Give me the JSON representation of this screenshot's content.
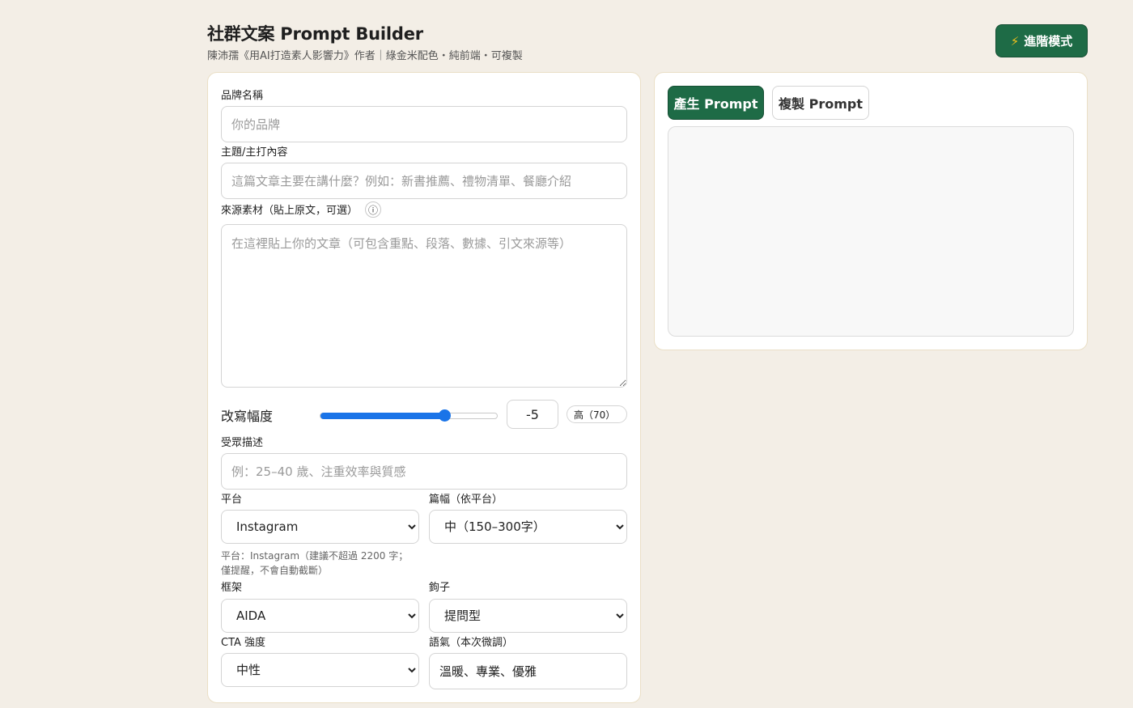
{
  "header": {
    "title": "社群文案 Prompt Builder",
    "subtitle": "陳沛孺《用AI打造素人影響力》作者｜綠金米配色・純前端・可複製",
    "advanced_button": "進階模式",
    "advanced_icon": "lightning-icon"
  },
  "form": {
    "brand": {
      "label": "品牌名稱",
      "placeholder": "你的品牌",
      "value": ""
    },
    "topic": {
      "label": "主題/主打內容",
      "placeholder": "這篇文章主要在講什麼？例如：新書推薦、禮物清單、餐廳介紹",
      "value": ""
    },
    "source": {
      "label": "來源素材（貼上原文，可選）",
      "info_icon": "ⓘ",
      "placeholder": "在這裡貼上你的文章（可包含重點、段落、數據、引文來源等）",
      "value": ""
    },
    "rewrite": {
      "label": "改寫幅度",
      "slider_fraction": 0.7,
      "number_value": "-5",
      "level_text": "高（70）"
    },
    "audience": {
      "label": "受眾描述",
      "placeholder": "例：25–40 歲、注重效率與質感",
      "value": ""
    },
    "platform": {
      "label": "平台",
      "selected": "Instagram",
      "hint": "平台：Instagram（建議不超過 2200 字；僅提醒，不會自動截斷）"
    },
    "length": {
      "label": "篇幅（依平台）",
      "selected": "中（150–300字）"
    },
    "framework": {
      "label": "框架",
      "selected": "AIDA"
    },
    "hook": {
      "label": "鉤子",
      "selected": "提問型"
    },
    "cta": {
      "label": "CTA 強度",
      "selected": "中性"
    },
    "tone": {
      "label": "語氣（本次微調）",
      "value": "溫暖、專業、優雅"
    }
  },
  "output": {
    "generate_button": "產生 Prompt",
    "copy_button": "複製 Prompt",
    "text": ""
  },
  "colors": {
    "accent_green": "#1e6b46",
    "background": "#f3eee6",
    "card_border": "#eadfc6",
    "slider_blue": "#1a74e8"
  }
}
